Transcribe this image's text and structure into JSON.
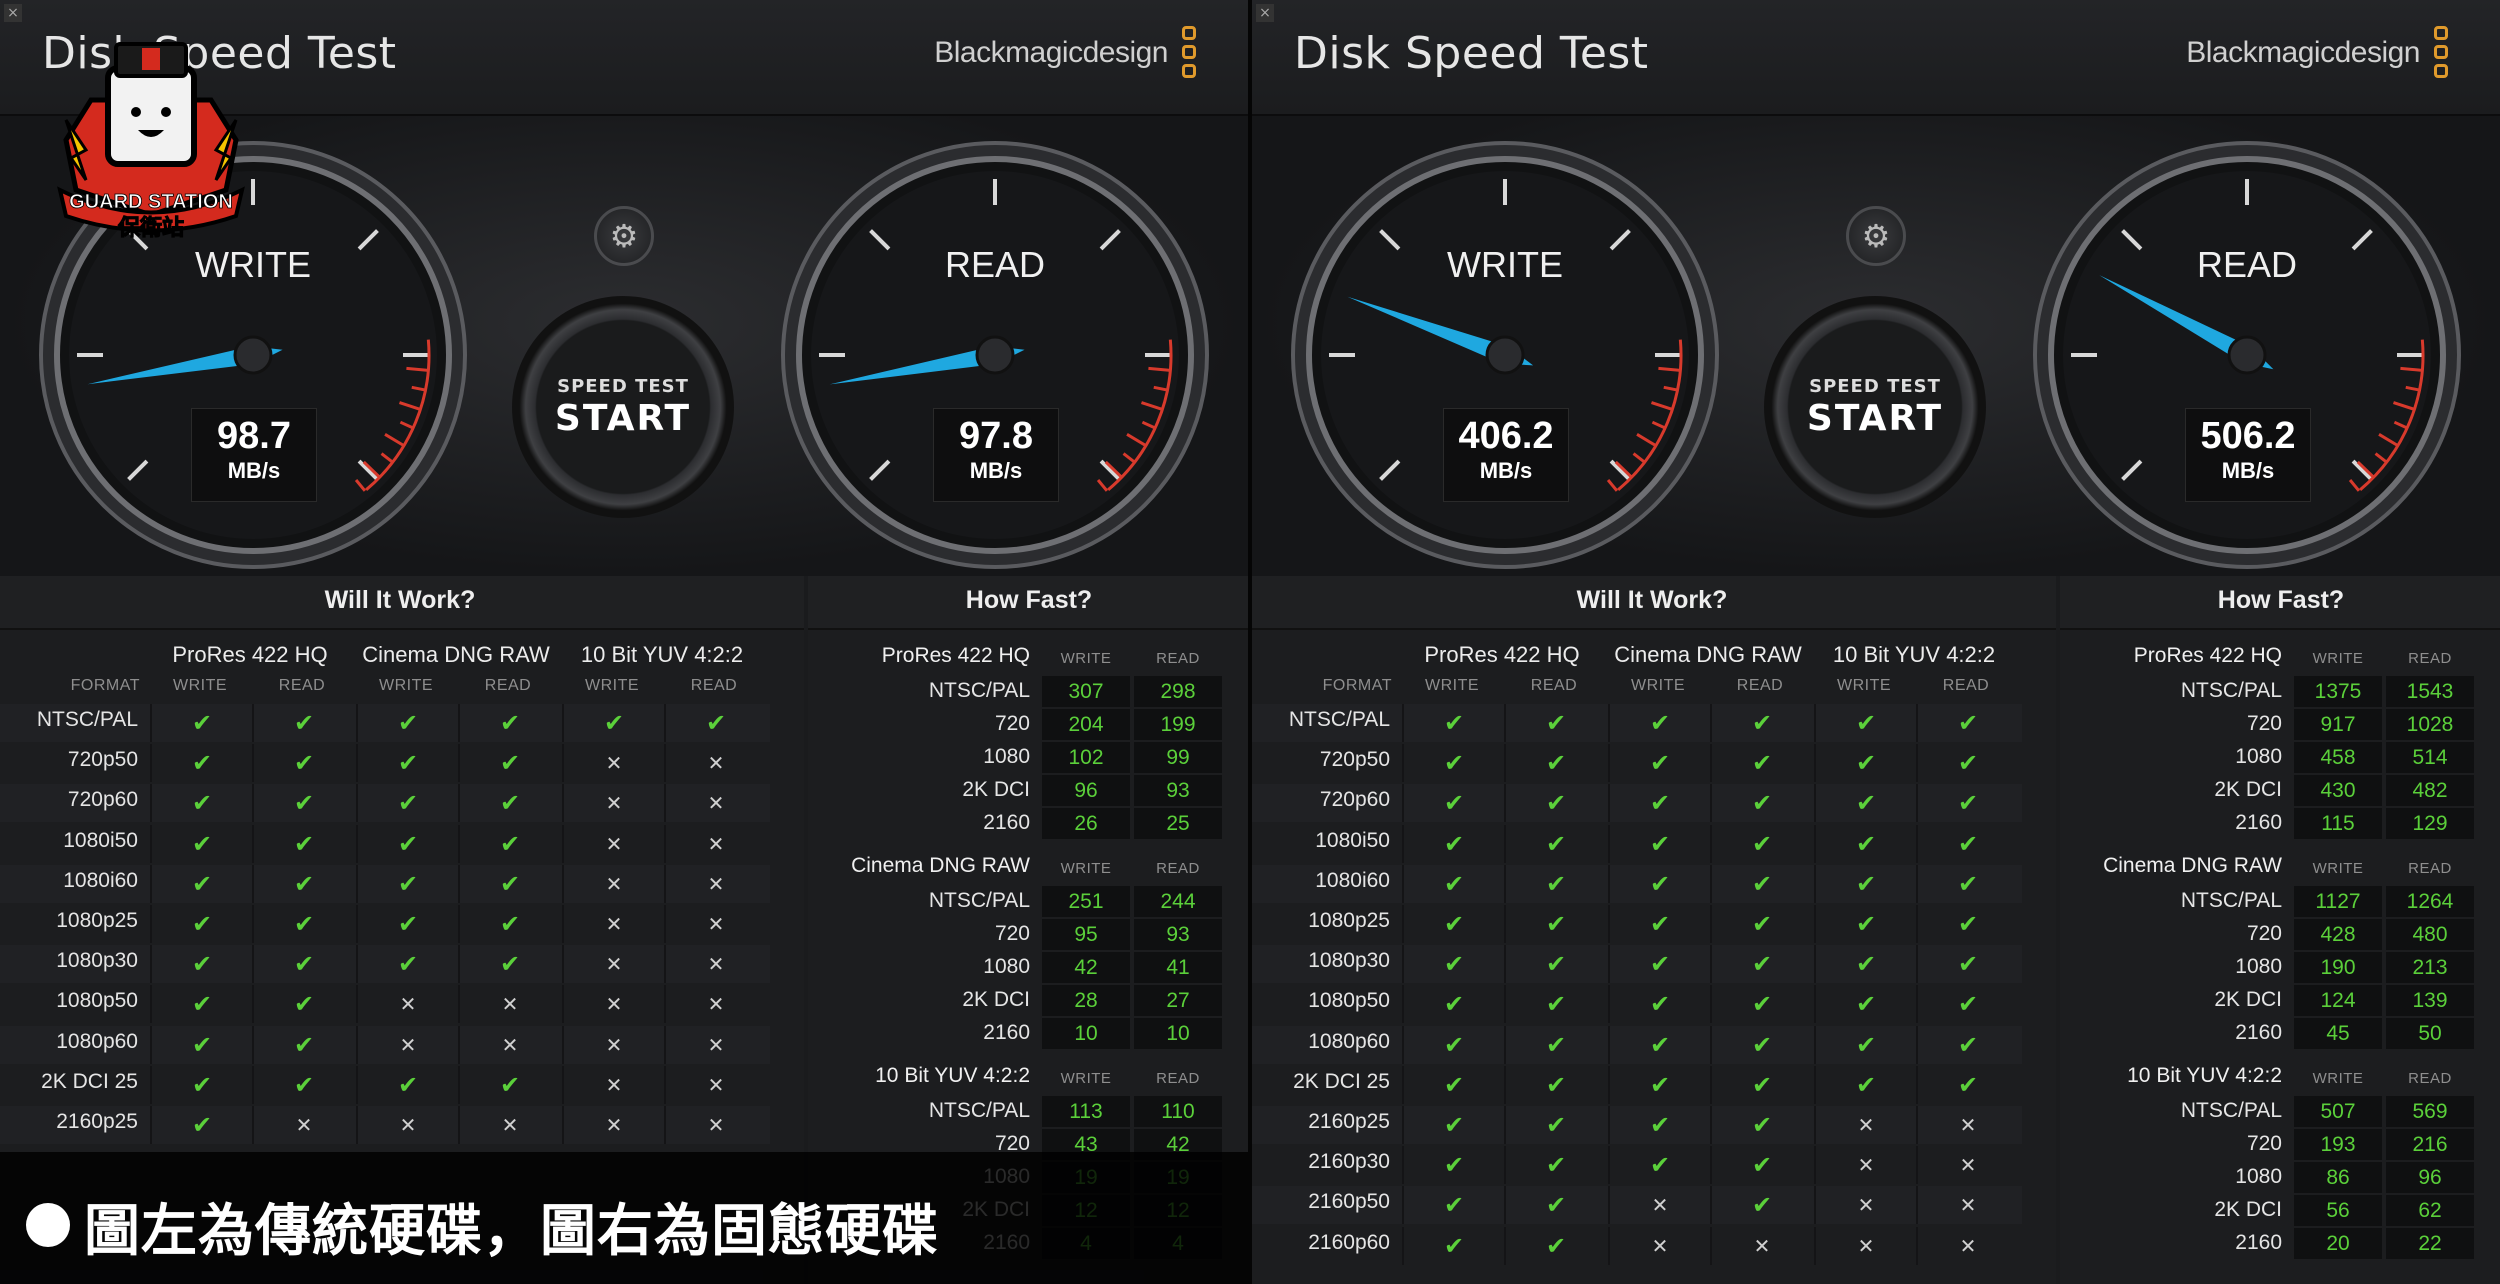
{
  "caption": "圖左為傳統硬碟，圖右為固態硬碟",
  "logo": {
    "text_top": "GUARD STATION",
    "text_bottom": "保衛站"
  },
  "colors": {
    "needle": "#1fa8e0",
    "ok": "#5bd03a",
    "redzone": "#d83a2c",
    "brand": "#e09a2c"
  },
  "panels": [
    {
      "id": "left",
      "title": "Disk Speed Test",
      "brand": "Blackmagicdesign",
      "settings_icon": "gear-icon",
      "start": {
        "small": "SPEED TEST",
        "big": "START"
      },
      "write": {
        "label": "WRITE",
        "value": "98.7",
        "unit": "MB/s"
      },
      "read": {
        "label": "READ",
        "value": "97.8",
        "unit": "MB/s"
      },
      "will_it_work": {
        "title": "Will It Work?",
        "format_label": "FORMAT",
        "codecs": [
          "ProRes 422 HQ",
          "Cinema DNG RAW",
          "10 Bit YUV 4:2:2"
        ],
        "sub_labels": [
          "WRITE",
          "READ"
        ],
        "rows": [
          {
            "format": "NTSC/PAL",
            "cells": [
              1,
              1,
              1,
              1,
              1,
              1
            ]
          },
          {
            "format": "720p50",
            "cells": [
              1,
              1,
              1,
              1,
              0,
              0
            ]
          },
          {
            "format": "720p60",
            "cells": [
              1,
              1,
              1,
              1,
              0,
              0
            ]
          },
          {
            "format": "1080i50",
            "cells": [
              1,
              1,
              1,
              1,
              0,
              0
            ]
          },
          {
            "format": "1080i60",
            "cells": [
              1,
              1,
              1,
              1,
              0,
              0
            ]
          },
          {
            "format": "1080p25",
            "cells": [
              1,
              1,
              1,
              1,
              0,
              0
            ]
          },
          {
            "format": "1080p30",
            "cells": [
              1,
              1,
              1,
              1,
              0,
              0
            ]
          },
          {
            "format": "1080p50",
            "cells": [
              1,
              1,
              0,
              0,
              0,
              0
            ]
          },
          {
            "format": "1080p60",
            "cells": [
              1,
              1,
              0,
              0,
              0,
              0
            ]
          },
          {
            "format": "2K DCI 25",
            "cells": [
              1,
              1,
              1,
              1,
              0,
              0
            ]
          },
          {
            "format": "2160p25",
            "cells": [
              1,
              0,
              0,
              0,
              0,
              0
            ]
          }
        ]
      },
      "how_fast": {
        "title": "How Fast?",
        "col_labels": [
          "WRITE",
          "READ"
        ],
        "groups": [
          {
            "name": "ProRes 422 HQ",
            "rows": [
              {
                "res": "NTSC/PAL",
                "write": "307",
                "read": "298"
              },
              {
                "res": "720",
                "write": "204",
                "read": "199"
              },
              {
                "res": "1080",
                "write": "102",
                "read": "99"
              },
              {
                "res": "2K DCI",
                "write": "96",
                "read": "93"
              },
              {
                "res": "2160",
                "write": "26",
                "read": "25"
              }
            ]
          },
          {
            "name": "Cinema DNG RAW",
            "rows": [
              {
                "res": "NTSC/PAL",
                "write": "251",
                "read": "244"
              },
              {
                "res": "720",
                "write": "95",
                "read": "93"
              },
              {
                "res": "1080",
                "write": "42",
                "read": "41"
              },
              {
                "res": "2K DCI",
                "write": "28",
                "read": "27"
              },
              {
                "res": "2160",
                "write": "10",
                "read": "10"
              }
            ]
          },
          {
            "name": "10 Bit YUV 4:2:2",
            "rows": [
              {
                "res": "NTSC/PAL",
                "write": "113",
                "read": "110"
              },
              {
                "res": "720",
                "write": "43",
                "read": "42"
              },
              {
                "res": "1080",
                "write": "19",
                "read": "19"
              },
              {
                "res": "2K DCI",
                "write": "12",
                "read": "12"
              },
              {
                "res": "2160",
                "write": "4",
                "read": "4"
              }
            ]
          }
        ]
      }
    },
    {
      "id": "right",
      "title": "Disk Speed Test",
      "brand": "Blackmagicdesign",
      "settings_icon": "gear-icon",
      "start": {
        "small": "SPEED TEST",
        "big": "START"
      },
      "write": {
        "label": "WRITE",
        "value": "406.2",
        "unit": "MB/s"
      },
      "read": {
        "label": "READ",
        "value": "506.2",
        "unit": "MB/s"
      },
      "will_it_work": {
        "title": "Will It Work?",
        "format_label": "FORMAT",
        "codecs": [
          "ProRes 422 HQ",
          "Cinema DNG RAW",
          "10 Bit YUV 4:2:2"
        ],
        "sub_labels": [
          "WRITE",
          "READ"
        ],
        "rows": [
          {
            "format": "NTSC/PAL",
            "cells": [
              1,
              1,
              1,
              1,
              1,
              1
            ]
          },
          {
            "format": "720p50",
            "cells": [
              1,
              1,
              1,
              1,
              1,
              1
            ]
          },
          {
            "format": "720p60",
            "cells": [
              1,
              1,
              1,
              1,
              1,
              1
            ]
          },
          {
            "format": "1080i50",
            "cells": [
              1,
              1,
              1,
              1,
              1,
              1
            ]
          },
          {
            "format": "1080i60",
            "cells": [
              1,
              1,
              1,
              1,
              1,
              1
            ]
          },
          {
            "format": "1080p25",
            "cells": [
              1,
              1,
              1,
              1,
              1,
              1
            ]
          },
          {
            "format": "1080p30",
            "cells": [
              1,
              1,
              1,
              1,
              1,
              1
            ]
          },
          {
            "format": "1080p50",
            "cells": [
              1,
              1,
              1,
              1,
              1,
              1
            ]
          },
          {
            "format": "1080p60",
            "cells": [
              1,
              1,
              1,
              1,
              1,
              1
            ]
          },
          {
            "format": "2K DCI 25",
            "cells": [
              1,
              1,
              1,
              1,
              1,
              1
            ]
          },
          {
            "format": "2160p25",
            "cells": [
              1,
              1,
              1,
              1,
              0,
              0
            ]
          },
          {
            "format": "2160p30",
            "cells": [
              1,
              1,
              1,
              1,
              0,
              0
            ]
          },
          {
            "format": "2160p50",
            "cells": [
              1,
              1,
              0,
              1,
              0,
              0
            ]
          },
          {
            "format": "2160p60",
            "cells": [
              1,
              1,
              0,
              0,
              0,
              0
            ]
          }
        ]
      },
      "how_fast": {
        "title": "How Fast?",
        "col_labels": [
          "WRITE",
          "READ"
        ],
        "groups": [
          {
            "name": "ProRes 422 HQ",
            "rows": [
              {
                "res": "NTSC/PAL",
                "write": "1375",
                "read": "1543"
              },
              {
                "res": "720",
                "write": "917",
                "read": "1028"
              },
              {
                "res": "1080",
                "write": "458",
                "read": "514"
              },
              {
                "res": "2K DCI",
                "write": "430",
                "read": "482"
              },
              {
                "res": "2160",
                "write": "115",
                "read": "129"
              }
            ]
          },
          {
            "name": "Cinema DNG RAW",
            "rows": [
              {
                "res": "NTSC/PAL",
                "write": "1127",
                "read": "1264"
              },
              {
                "res": "720",
                "write": "428",
                "read": "480"
              },
              {
                "res": "1080",
                "write": "190",
                "read": "213"
              },
              {
                "res": "2K DCI",
                "write": "124",
                "read": "139"
              },
              {
                "res": "2160",
                "write": "45",
                "read": "50"
              }
            ]
          },
          {
            "name": "10 Bit YUV 4:2:2",
            "rows": [
              {
                "res": "NTSC/PAL",
                "write": "507",
                "read": "569"
              },
              {
                "res": "720",
                "write": "193",
                "read": "216"
              },
              {
                "res": "1080",
                "write": "86",
                "read": "96"
              },
              {
                "res": "2K DCI",
                "write": "56",
                "read": "62"
              },
              {
                "res": "2160",
                "write": "20",
                "read": "22"
              }
            ]
          }
        ]
      }
    }
  ]
}
